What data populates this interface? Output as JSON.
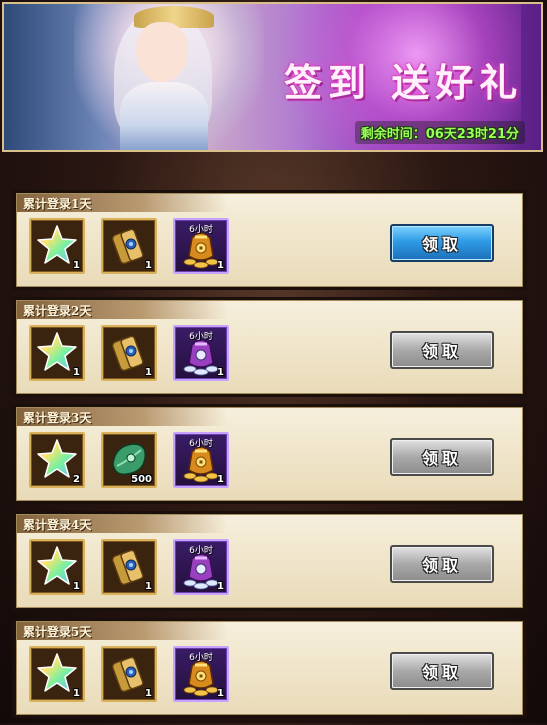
{
  "banner": {
    "title": "签到 送好礼",
    "countdown": "剩余时间：06天23时21分"
  },
  "rows": [
    {
      "label": "累计登录1天",
      "button": {
        "label": "领取",
        "state": "active"
      },
      "items": [
        {
          "icon": "rainbow-star-icon",
          "qty": "1",
          "tag": ""
        },
        {
          "icon": "scroll-icon",
          "qty": "1",
          "tag": ""
        },
        {
          "icon": "gold-bag-icon",
          "qty": "1",
          "tag": "6小时",
          "frame": "purple"
        }
      ]
    },
    {
      "label": "累计登录2天",
      "button": {
        "label": "领取",
        "state": "inactive"
      },
      "items": [
        {
          "icon": "rainbow-star-icon",
          "qty": "1",
          "tag": ""
        },
        {
          "icon": "scroll-icon",
          "qty": "1",
          "tag": ""
        },
        {
          "icon": "silver-bag-icon",
          "qty": "1",
          "tag": "6小时",
          "frame": "purple"
        }
      ]
    },
    {
      "label": "累计登录3天",
      "button": {
        "label": "领取",
        "state": "inactive"
      },
      "items": [
        {
          "icon": "rainbow-star-icon",
          "qty": "2",
          "tag": ""
        },
        {
          "icon": "jade-leaf-icon",
          "qty": "500",
          "tag": ""
        },
        {
          "icon": "gold-bag-icon",
          "qty": "1",
          "tag": "6小时",
          "frame": "purple"
        }
      ]
    },
    {
      "label": "累计登录4天",
      "button": {
        "label": "领取",
        "state": "inactive"
      },
      "items": [
        {
          "icon": "rainbow-star-icon",
          "qty": "1",
          "tag": ""
        },
        {
          "icon": "scroll-icon",
          "qty": "1",
          "tag": ""
        },
        {
          "icon": "silver-bag-icon",
          "qty": "1",
          "tag": "6小时",
          "frame": "purple"
        }
      ]
    },
    {
      "label": "累计登录5天",
      "button": {
        "label": "领取",
        "state": "inactive"
      },
      "items": [
        {
          "icon": "rainbow-star-icon",
          "qty": "1",
          "tag": ""
        },
        {
          "icon": "scroll-icon",
          "qty": "1",
          "tag": ""
        },
        {
          "icon": "gold-bag-icon",
          "qty": "1",
          "tag": "6小时",
          "frame": "purple"
        }
      ]
    }
  ],
  "colors": {
    "countdown": "#9bff5a",
    "active_button": "#2f9be6",
    "inactive_button": "#a9a9a9",
    "panel": "#f6efdc"
  }
}
